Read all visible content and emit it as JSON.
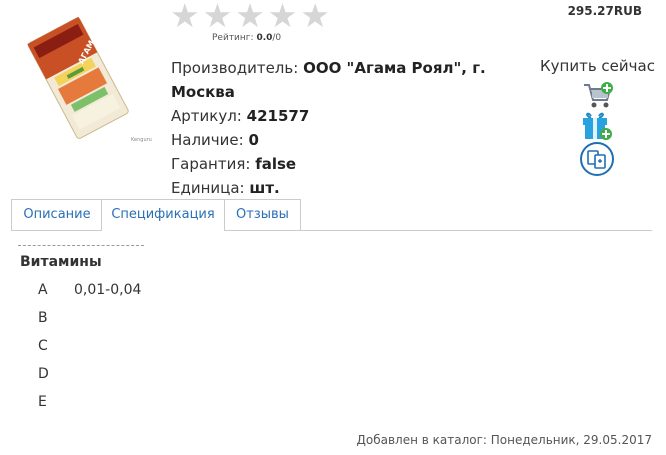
{
  "product": {
    "image_alt": "АГАМА",
    "rating": {
      "stars": 5,
      "filled": 0,
      "label": "Рейтинг:",
      "value": "0.0",
      "count": "/0"
    },
    "price": "295.27RUB",
    "manufacturer_label": "Производитель:",
    "manufacturer_value": "ООО \"Агама Роял\", г. Москва",
    "sku_label": "Артикул:",
    "sku_value": "421577",
    "stock_label": "Наличие:",
    "stock_value": "0",
    "warranty_label": "Гарантия:",
    "warranty_value": "false",
    "unit_label": "Единица:",
    "unit_value": "шт."
  },
  "actions": {
    "buy_now_label": "Купить сейчас",
    "icons": [
      "add-to-cart-icon",
      "gift-add-icon",
      "compare-icon"
    ]
  },
  "tabs": [
    {
      "label": "Описание",
      "active": false
    },
    {
      "label": "Спецификация",
      "active": true
    },
    {
      "label": "Отзывы",
      "active": false
    }
  ],
  "specification": {
    "group_title": "Витамины",
    "rows": [
      {
        "name": "A",
        "value": "0,01-0,04"
      },
      {
        "name": "B",
        "value": ""
      },
      {
        "name": "C",
        "value": ""
      },
      {
        "name": "D",
        "value": ""
      },
      {
        "name": "E",
        "value": ""
      }
    ]
  },
  "footer": {
    "added_text": "Добавлен в каталог: Понедельник, 29.05.2017"
  },
  "colors": {
    "link": "#2a6fb6",
    "star_empty": "#d6d6d6",
    "text": "#333333"
  }
}
